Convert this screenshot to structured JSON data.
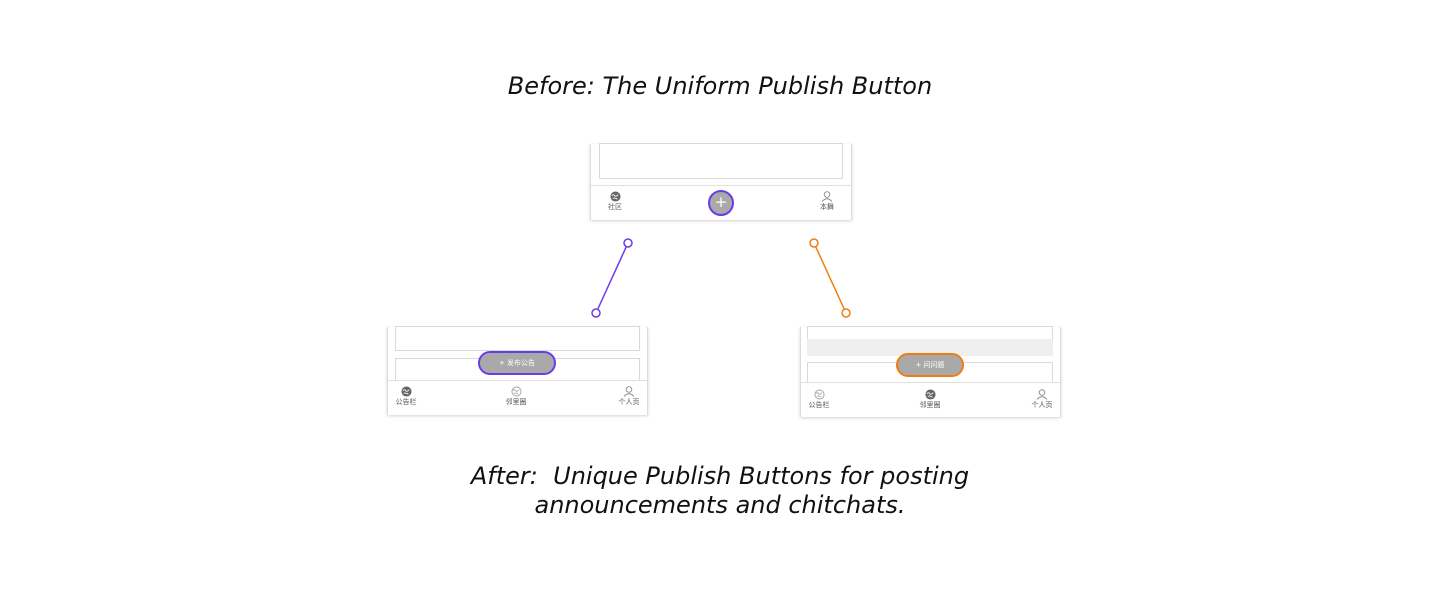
{
  "captions": {
    "before": "Before: The Uniform Publish Button",
    "after_line1": "After:  Unique Publish Buttons for posting",
    "after_line2": "announcements and chitchats."
  },
  "colors": {
    "purple": "#6a3be8",
    "orange": "#f07d10",
    "button_gray": "#a9a9a9",
    "text": "#111111"
  },
  "before_screen": {
    "tabs": [
      {
        "icon": "globe-icon",
        "label": "社区"
      },
      {
        "icon": "person-icon",
        "label": "本舞"
      }
    ],
    "publish_symbol": "+"
  },
  "after_left": {
    "publish_label": "+ 发布公告",
    "tabs": [
      {
        "icon": "globe-icon",
        "label": "公告栏"
      },
      {
        "icon": "globe-icon",
        "label": "邻里圈"
      },
      {
        "icon": "person-icon",
        "label": "个人页"
      }
    ]
  },
  "after_right": {
    "publish_label": "+ 问问题",
    "tabs": [
      {
        "icon": "globe-icon",
        "label": "公告栏"
      },
      {
        "icon": "globe-icon",
        "label": "邻里圈"
      },
      {
        "icon": "person-icon",
        "label": "个人页"
      }
    ]
  }
}
